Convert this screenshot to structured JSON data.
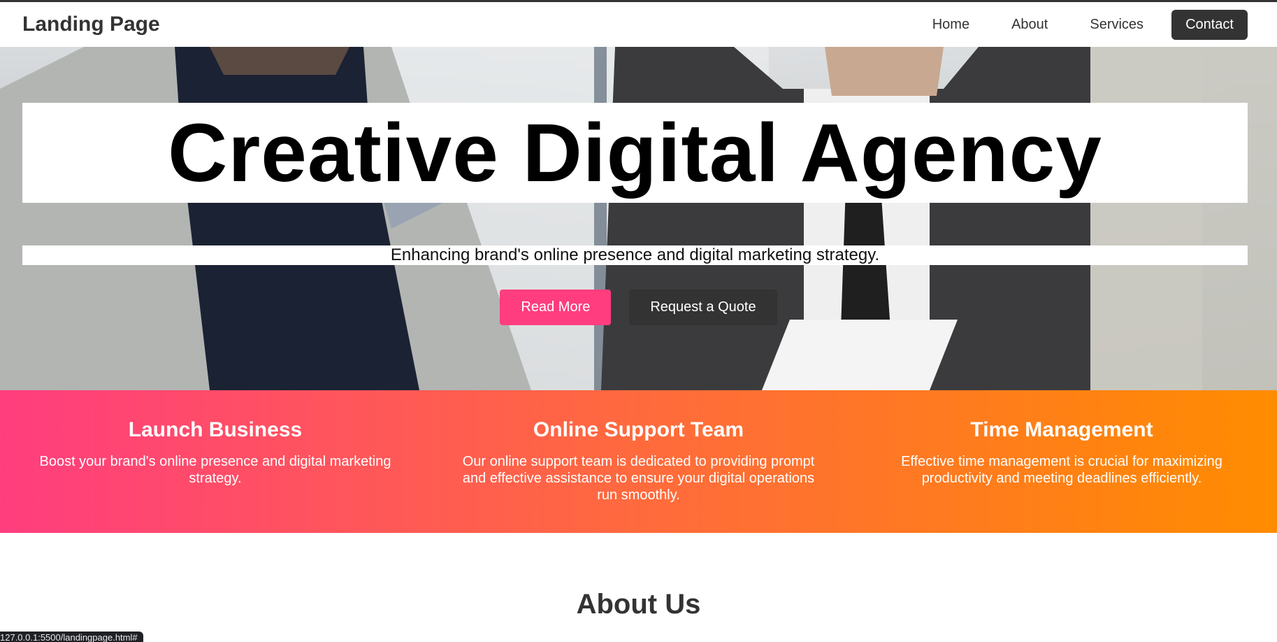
{
  "navbar": {
    "brand": "Landing Page",
    "links": [
      "Home",
      "About",
      "Services"
    ],
    "contact": "Contact"
  },
  "hero": {
    "title": "Creative Digital Agency",
    "subtitle": "Enhancing brand's online presence and digital marketing strategy.",
    "primary_button": "Read More",
    "secondary_button": "Request a Quote"
  },
  "features": [
    {
      "title": "Launch Business",
      "text": "Boost your brand's online presence and digital marketing strategy."
    },
    {
      "title": "Online Support Team",
      "text": "Our online support team is dedicated to providing prompt and effective assistance to ensure your digital operations run smoothly."
    },
    {
      "title": "Time Management",
      "text": "Effective time management is crucial for maximizing productivity and meeting deadlines efficiently."
    }
  ],
  "about": {
    "title": "About Us"
  },
  "status_bar": {
    "url": "127.0.0.1:5500/landingpage.html#"
  },
  "colors": {
    "accent_pink": "#ff3d7f",
    "accent_orange": "#ff8c00",
    "dark": "#333333"
  }
}
